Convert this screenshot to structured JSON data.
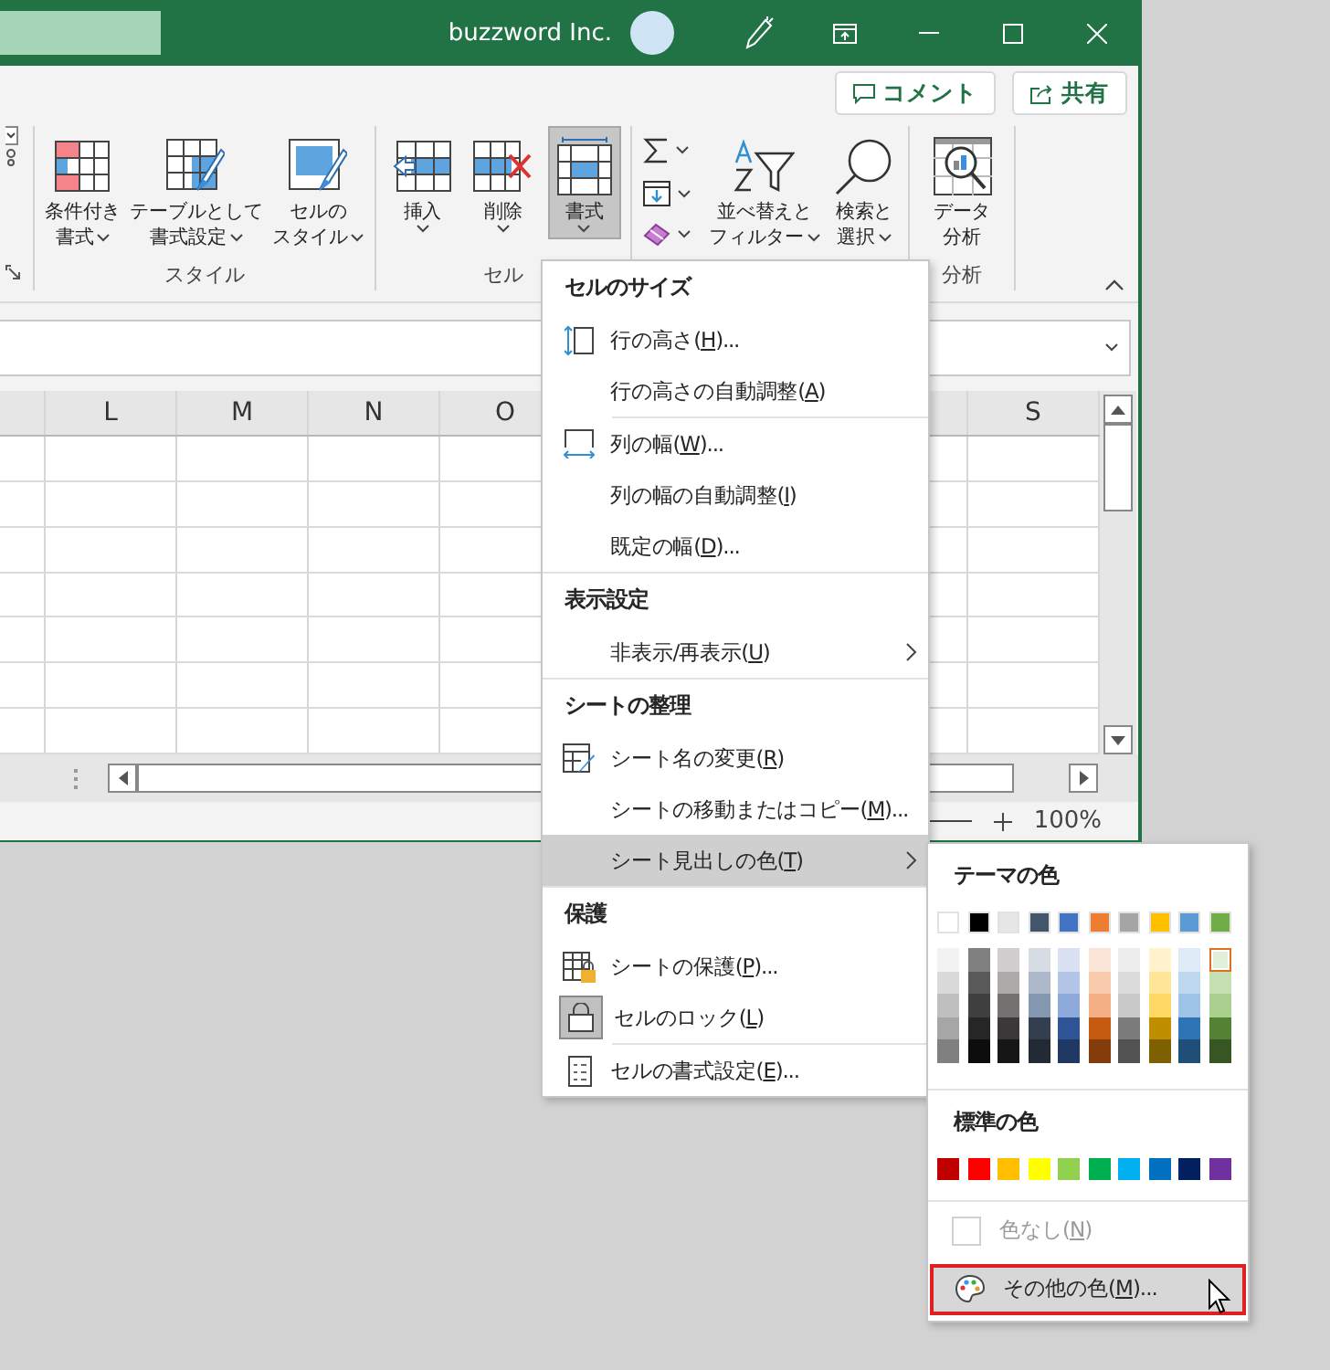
{
  "title_bar": {
    "account": "buzzword Inc."
  },
  "ribbon": {
    "actions": [
      {
        "label": "コメント"
      },
      {
        "label": "共有"
      }
    ],
    "groups": [
      {
        "label": "スタイル",
        "buttons": [
          {
            "lines": [
              "条件付き",
              "書式"
            ],
            "dropdown": true,
            "selected": false
          },
          {
            "lines": [
              "テーブルとして",
              "書式設定"
            ],
            "dropdown": true,
            "selected": false
          },
          {
            "lines": [
              "セルの",
              "スタイル"
            ],
            "dropdown": true,
            "selected": false
          }
        ]
      },
      {
        "label": "セル",
        "buttons": [
          {
            "lines": [
              "挿入"
            ],
            "dropdown": true,
            "selected": false
          },
          {
            "lines": [
              "削除"
            ],
            "dropdown": true,
            "selected": false
          },
          {
            "lines": [
              "書式"
            ],
            "dropdown": true,
            "selected": true
          }
        ]
      },
      {
        "small_buttons": [
          {
            "dropdown": true
          },
          {
            "dropdown": true
          },
          {
            "dropdown": true
          }
        ],
        "buttons": [
          {
            "lines": [
              "並べ替えと",
              "フィルター"
            ],
            "dropdown": true,
            "selected": false
          },
          {
            "lines": [
              "検索と",
              "選択"
            ],
            "dropdown": true,
            "selected": false
          }
        ]
      },
      {
        "label": "分析",
        "buttons": [
          {
            "lines": [
              "データ",
              "分析"
            ],
            "dropdown": false,
            "selected": false
          }
        ]
      }
    ]
  },
  "grid": {
    "columns": [
      {
        "label": "L"
      },
      {
        "label": "M"
      },
      {
        "label": "N"
      },
      {
        "label": "O"
      }
    ],
    "far_columns": [
      {
        "label": "S"
      }
    ]
  },
  "status_bar": {
    "zoom": "100%"
  },
  "menu": {
    "sections": [
      {
        "title": "セルのサイズ",
        "groups": [
          [
            {
              "before": "行の高さ(",
              "accel": "H",
              "after": ")...",
              "submenu": false,
              "selected": false,
              "checked": false
            },
            {
              "before": "行の高さの自動調整(",
              "accel": "A",
              "after": ")",
              "submenu": false,
              "selected": false,
              "checked": false
            }
          ],
          [
            {
              "before": "列の幅(",
              "accel": "W",
              "after": ")...",
              "submenu": false,
              "selected": false,
              "checked": false
            },
            {
              "before": "列の幅の自動調整(",
              "accel": "I",
              "after": ")",
              "submenu": false,
              "selected": false,
              "checked": false
            },
            {
              "before": "既定の幅(",
              "accel": "D",
              "after": ")...",
              "submenu": false,
              "selected": false,
              "checked": false
            }
          ]
        ]
      },
      {
        "title": "表示設定",
        "groups": [
          [
            {
              "before": "非表示/再表示(",
              "accel": "U",
              "after": ")",
              "submenu": true,
              "selected": false,
              "checked": false
            }
          ]
        ]
      },
      {
        "title": "シートの整理",
        "groups": [
          [
            {
              "before": "シート名の変更(",
              "accel": "R",
              "after": ")",
              "submenu": false,
              "selected": false,
              "checked": false
            },
            {
              "before": "シートの移動またはコピー(",
              "accel": "M",
              "after": ")...",
              "submenu": false,
              "selected": false,
              "checked": false
            },
            {
              "before": "シート見出しの色(",
              "accel": "T",
              "after": ")",
              "submenu": true,
              "selected": true,
              "checked": false
            }
          ]
        ]
      },
      {
        "title": "保護",
        "groups": [
          [
            {
              "before": "シートの保護(",
              "accel": "P",
              "after": ")...",
              "submenu": false,
              "selected": false,
              "checked": false
            },
            {
              "before": "セルのロック(",
              "accel": "L",
              "after": ")",
              "submenu": false,
              "selected": false,
              "checked": true
            }
          ],
          [
            {
              "before": "セルの書式設定(",
              "accel": "E",
              "after": ")...",
              "submenu": false,
              "selected": false,
              "checked": false
            }
          ]
        ]
      }
    ]
  },
  "color_menu": {
    "theme_title": "テーマの色",
    "theme_colors": [
      {
        "color": "#ffffff"
      },
      {
        "color": "#000000"
      },
      {
        "color": "#e7e6e6"
      },
      {
        "color": "#44546a"
      },
      {
        "color": "#4472c4"
      },
      {
        "color": "#ed7d31"
      },
      {
        "color": "#a5a5a5"
      },
      {
        "color": "#ffc000"
      },
      {
        "color": "#5b9bd5"
      },
      {
        "color": "#70ad47"
      }
    ],
    "shades": [
      [
        {
          "color": "#f2f2f2",
          "selected": false
        },
        {
          "color": "#d9d9d9",
          "selected": false
        },
        {
          "color": "#bfbfbf",
          "selected": false
        },
        {
          "color": "#a6a6a6",
          "selected": false
        },
        {
          "color": "#808080",
          "selected": false
        }
      ],
      [
        {
          "color": "#808080",
          "selected": false
        },
        {
          "color": "#595959",
          "selected": false
        },
        {
          "color": "#404040",
          "selected": false
        },
        {
          "color": "#262626",
          "selected": false
        },
        {
          "color": "#0d0d0d",
          "selected": false
        }
      ],
      [
        {
          "color": "#d0cece",
          "selected": false
        },
        {
          "color": "#aeaaaa",
          "selected": false
        },
        {
          "color": "#757171",
          "selected": false
        },
        {
          "color": "#3a3838",
          "selected": false
        },
        {
          "color": "#171616",
          "selected": false
        }
      ],
      [
        {
          "color": "#d6dce4",
          "selected": false
        },
        {
          "color": "#adb9ca",
          "selected": false
        },
        {
          "color": "#8497b0",
          "selected": false
        },
        {
          "color": "#333f4f",
          "selected": false
        },
        {
          "color": "#222a35",
          "selected": false
        }
      ],
      [
        {
          "color": "#d9e1f2",
          "selected": false
        },
        {
          "color": "#b4c6e7",
          "selected": false
        },
        {
          "color": "#8ea9db",
          "selected": false
        },
        {
          "color": "#2f5597",
          "selected": false
        },
        {
          "color": "#203864",
          "selected": false
        }
      ],
      [
        {
          "color": "#fbe5d6",
          "selected": false
        },
        {
          "color": "#f8cbad",
          "selected": false
        },
        {
          "color": "#f4b084",
          "selected": false
        },
        {
          "color": "#c55a11",
          "selected": false
        },
        {
          "color": "#843c0c",
          "selected": false
        }
      ],
      [
        {
          "color": "#ededed",
          "selected": false
        },
        {
          "color": "#dbdbdb",
          "selected": false
        },
        {
          "color": "#c9c9c9",
          "selected": false
        },
        {
          "color": "#7b7b7b",
          "selected": false
        },
        {
          "color": "#525252",
          "selected": false
        }
      ],
      [
        {
          "color": "#fff2cc",
          "selected": false
        },
        {
          "color": "#ffe699",
          "selected": false
        },
        {
          "color": "#ffd966",
          "selected": false
        },
        {
          "color": "#bf8f00",
          "selected": false
        },
        {
          "color": "#7f6000",
          "selected": false
        }
      ],
      [
        {
          "color": "#deebf7",
          "selected": false
        },
        {
          "color": "#bdd7ee",
          "selected": false
        },
        {
          "color": "#9dc3e6",
          "selected": false
        },
        {
          "color": "#2e75b6",
          "selected": false
        },
        {
          "color": "#1f4e79",
          "selected": false
        }
      ],
      [
        {
          "color": "#e2efda",
          "selected": true
        },
        {
          "color": "#c6e0b4",
          "selected": false
        },
        {
          "color": "#a9d08e",
          "selected": false
        },
        {
          "color": "#548235",
          "selected": false
        },
        {
          "color": "#375623",
          "selected": false
        }
      ]
    ],
    "standard_title": "標準の色",
    "standard_colors": [
      {
        "color": "#c00000"
      },
      {
        "color": "#ff0000"
      },
      {
        "color": "#ffc000"
      },
      {
        "color": "#ffff00"
      },
      {
        "color": "#92d050"
      },
      {
        "color": "#00b050"
      },
      {
        "color": "#00b0f0"
      },
      {
        "color": "#0070c0"
      },
      {
        "color": "#002060"
      },
      {
        "color": "#7030a0"
      }
    ],
    "no_color": {
      "before": "色なし(",
      "accel": "N",
      "after": ")",
      "disabled": true
    },
    "more_colors": {
      "before": "その他の色(",
      "accel": "M",
      "after": ")...",
      "selected": true,
      "highlight_box": true
    }
  }
}
